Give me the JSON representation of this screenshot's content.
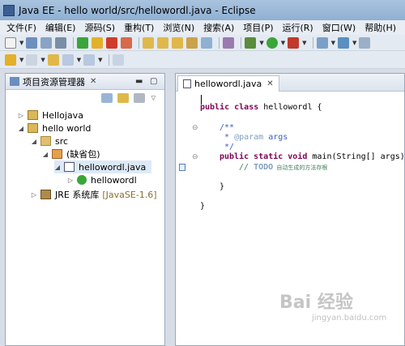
{
  "window": {
    "title": "Java EE  -  hello world/src/hellowordl.java  -  Eclipse"
  },
  "menu": [
    "文件(F)",
    "编辑(E)",
    "源码(S)",
    "重构(T)",
    "浏览(N)",
    "搜索(A)",
    "项目(P)",
    "运行(R)",
    "窗口(W)",
    "帮助(H)"
  ],
  "project_explorer": {
    "title": "项目资源管理器",
    "tree": [
      {
        "label": "Hellojava"
      },
      {
        "label": "hello world"
      },
      {
        "label": "src"
      },
      {
        "label": "(缺省包)"
      },
      {
        "label": "hellowordl.java"
      },
      {
        "label": "hellowordl"
      },
      {
        "label": "JRE 系统库",
        "tag": "[JavaSE-1.6]"
      }
    ]
  },
  "editor": {
    "tab_label": "hellowordl.java",
    "code": {
      "class_decl_kw": "public class",
      "class_name": " hellowordl {",
      "javadoc_open": "/**",
      "javadoc_star": " * ",
      "javadoc_param_tag": "@param",
      "javadoc_param_name": " args",
      "javadoc_close": " */",
      "method_kw": "public static void",
      "method_sig": " main(String[] args) {",
      "comment_prefix": "// ",
      "todo_word": "TODO",
      "todo_text": " 自动生成的方法存根",
      "method_close": "}",
      "class_close": "}"
    }
  },
  "watermark": {
    "brand": "Bai 经验",
    "sub": "jingyan.baidu.com"
  },
  "colors": {
    "keyword": "#7f0055",
    "javadoc": "#3f5fbf",
    "comment": "#3f7f5f",
    "selection": "#dde9f7"
  }
}
